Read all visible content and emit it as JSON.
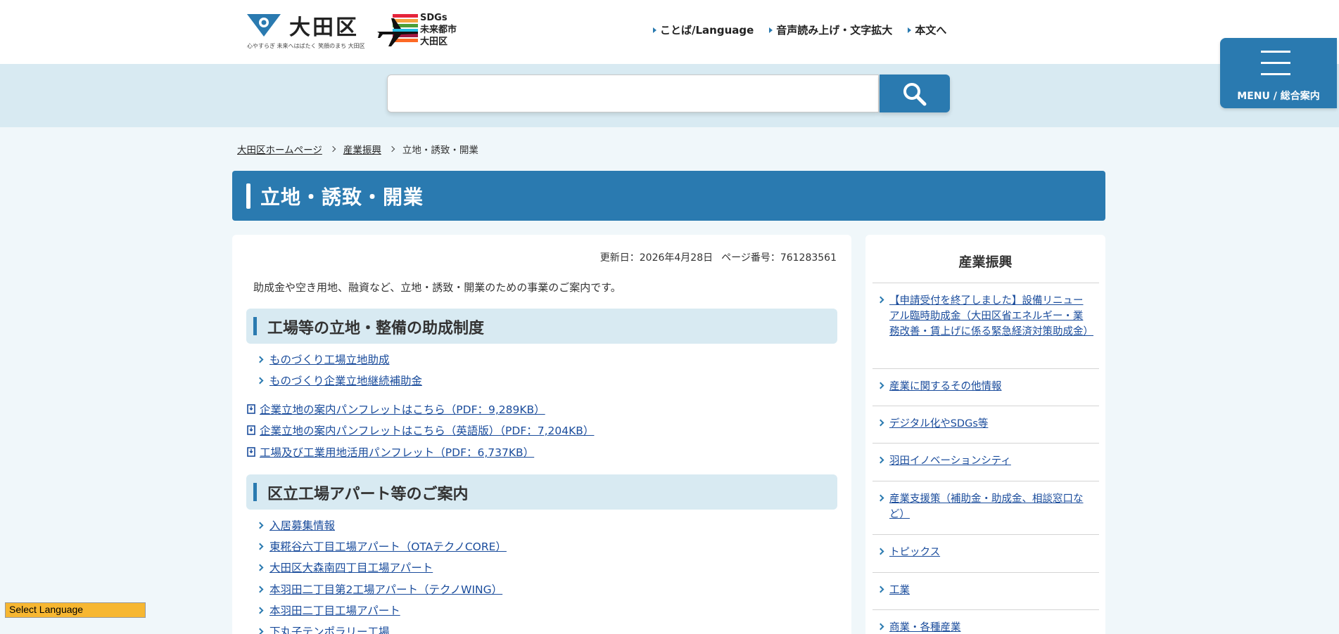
{
  "header": {
    "logo_title": "大田区",
    "logo_tagline": "心やすらぎ 未来へはばたく 笑顔のまち 大田区",
    "sdgs_line1": "SDGs",
    "sdgs_line2": "未来都市",
    "sdgs_line3": "大田区",
    "util_nav": [
      "ことば/Language",
      "音声読み上げ・文字拡大",
      "本文へ"
    ],
    "menu_label": "MENU / 総合案内"
  },
  "search": {
    "placeholder": "",
    "value": ""
  },
  "breadcrumb": [
    "大田区ホームページ",
    "産業振興",
    "立地・誘致・開業"
  ],
  "page_title": "立地・誘致・開業",
  "meta": {
    "updated": "更新日：2026年4月28日",
    "page_no": "ページ番号：761283561"
  },
  "intro": "助成金や空き用地、融資など、立地・誘致・開業のための事業のご案内です。",
  "section1": {
    "heading": "工場等の立地・整備の助成制度",
    "links": [
      "ものづくり工場立地助成",
      "ものづくり企業立地継続補助金"
    ],
    "pdfs": [
      "企業立地の案内パンフレットはこちら（PDF：9,289KB）",
      "企業立地の案内パンフレットはこちら（英語版）（PDF：7,204KB）",
      "工場及び工業用地活用パンフレット（PDF：6,737KB）"
    ]
  },
  "section2": {
    "heading": "区立工場アパート等のご案内",
    "links": [
      "入居募集情報",
      "東糀谷六丁目工場アパート（OTAテクノCORE）",
      "大田区大森南四丁目工場アパート",
      "本羽田二丁目第2工場アパート（テクノWING）",
      "本羽田二丁目工場アパート",
      "下丸子テンポラリー工場"
    ]
  },
  "sidebar": {
    "title": "産業振興",
    "items": [
      "【申請受付を終了しました】設備リニューアル臨時助成金（大田区省エネルギー・業務改善・賃上げに係る緊急経済対策助成金）",
      "産業に関するその他情報",
      "デジタル化やSDGs等",
      "羽田イノベーションシティ",
      "産業支援策（補助金・助成金、相談窓口など）",
      "トピックス",
      "工業",
      "商業・各種産業"
    ]
  },
  "language_select": "Select Language",
  "colors": {
    "primary": "#2a7ab0",
    "band": "#d8eaf2",
    "bg": "#f0f7fa",
    "link": "#1a4c9c",
    "lang_bg": "#f7b731"
  }
}
